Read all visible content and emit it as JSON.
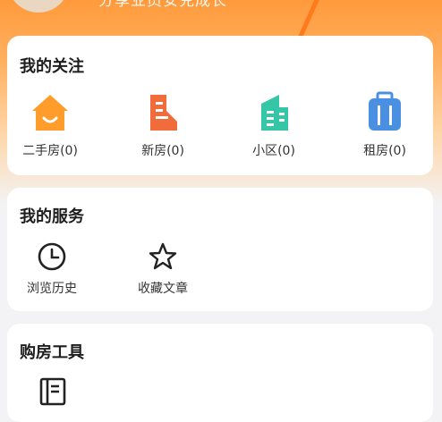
{
  "header": {
    "partial_text": "分享业员安兑成长"
  },
  "follow": {
    "title": "我的关注",
    "items": [
      {
        "label": "二手房(0)",
        "icon": "house-icon"
      },
      {
        "label": "新房(0)",
        "icon": "building-icon"
      },
      {
        "label": "小区(0)",
        "icon": "community-icon"
      },
      {
        "label": "租房(0)",
        "icon": "luggage-icon"
      }
    ]
  },
  "services": {
    "title": "我的服务",
    "items": [
      {
        "label": "浏览历史",
        "icon": "clock-icon"
      },
      {
        "label": "收藏文章",
        "icon": "star-icon"
      }
    ]
  },
  "tools": {
    "title": "购房工具",
    "items": [
      {
        "icon": "notebook-icon"
      }
    ]
  },
  "colors": {
    "accent": "#ff7a1a",
    "house": "#ff9c2a",
    "building": "#f06c3a",
    "community": "#34c6a7",
    "luggage": "#4a90e2"
  }
}
